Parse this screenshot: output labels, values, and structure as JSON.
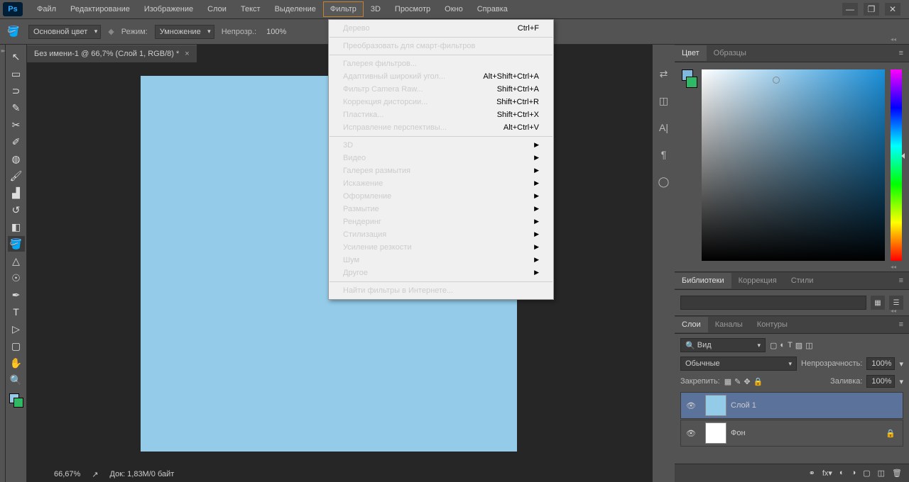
{
  "menubar": [
    "Файл",
    "Редактирование",
    "Изображение",
    "Слои",
    "Текст",
    "Выделение",
    "Фильтр",
    "3D",
    "Просмотр",
    "Окно",
    "Справка"
  ],
  "active_menu_index": 6,
  "options_bar": {
    "color_mode": "Основной цвет",
    "mode_label": "Режим:",
    "blend": "Умножение",
    "opacity_label": "Непрозр.:",
    "opacity": "100%"
  },
  "doc_tab": "Без имени-1 @ 66,7% (Слой 1, RGB/8) *",
  "dropdown": {
    "groups": [
      [
        {
          "label": "Дерево",
          "sc": "Ctrl+F"
        }
      ],
      [
        {
          "label": "Преобразовать для смарт-фильтров"
        }
      ],
      [
        {
          "label": "Галерея фильтров..."
        },
        {
          "label": "Адаптивный широкий угол...",
          "sc": "Alt+Shift+Ctrl+A"
        },
        {
          "label": "Фильтр Camera Raw...",
          "sc": "Shift+Ctrl+A"
        },
        {
          "label": "Коррекция дисторсии...",
          "sc": "Shift+Ctrl+R"
        },
        {
          "label": "Пластика...",
          "sc": "Shift+Ctrl+X"
        },
        {
          "label": "Исправление перспективы...",
          "sc": "Alt+Ctrl+V"
        }
      ],
      [
        {
          "label": "3D",
          "sub": true
        },
        {
          "label": "Видео",
          "sub": true
        },
        {
          "label": "Галерея размытия",
          "sub": true
        },
        {
          "label": "Искажение",
          "sub": true
        },
        {
          "label": "Оформление",
          "sub": true
        },
        {
          "label": "Размытие",
          "sub": true
        },
        {
          "label": "Рендеринг",
          "sub": true
        },
        {
          "label": "Стилизация",
          "sub": true
        },
        {
          "label": "Усиление резкости",
          "sub": true
        },
        {
          "label": "Шум",
          "sub": true
        },
        {
          "label": "Другое",
          "sub": true
        }
      ],
      [
        {
          "label": "Найти фильтры в Интернете..."
        }
      ]
    ]
  },
  "color_tabs": [
    "Цвет",
    "Образцы"
  ],
  "lib_tabs": [
    "Библиотеки",
    "Коррекция",
    "Стили"
  ],
  "layer_tabs": [
    "Слои",
    "Каналы",
    "Контуры"
  ],
  "layers": {
    "filter_kind": "Вид",
    "blend": "Обычные",
    "opacity_label": "Непрозрачность:",
    "opacity": "100%",
    "lock_label": "Закрепить:",
    "fill_label": "Заливка:",
    "fill": "100%",
    "items": [
      {
        "name": "Слой 1",
        "thumb": "#93cbe9",
        "sel": true,
        "locked": false
      },
      {
        "name": "Фон",
        "thumb": "#ffffff",
        "sel": false,
        "locked": true
      }
    ]
  },
  "status": {
    "zoom": "66,67%",
    "doc": "Док: 1,83M/0 байт"
  },
  "icons": {
    "search": "🔍"
  }
}
